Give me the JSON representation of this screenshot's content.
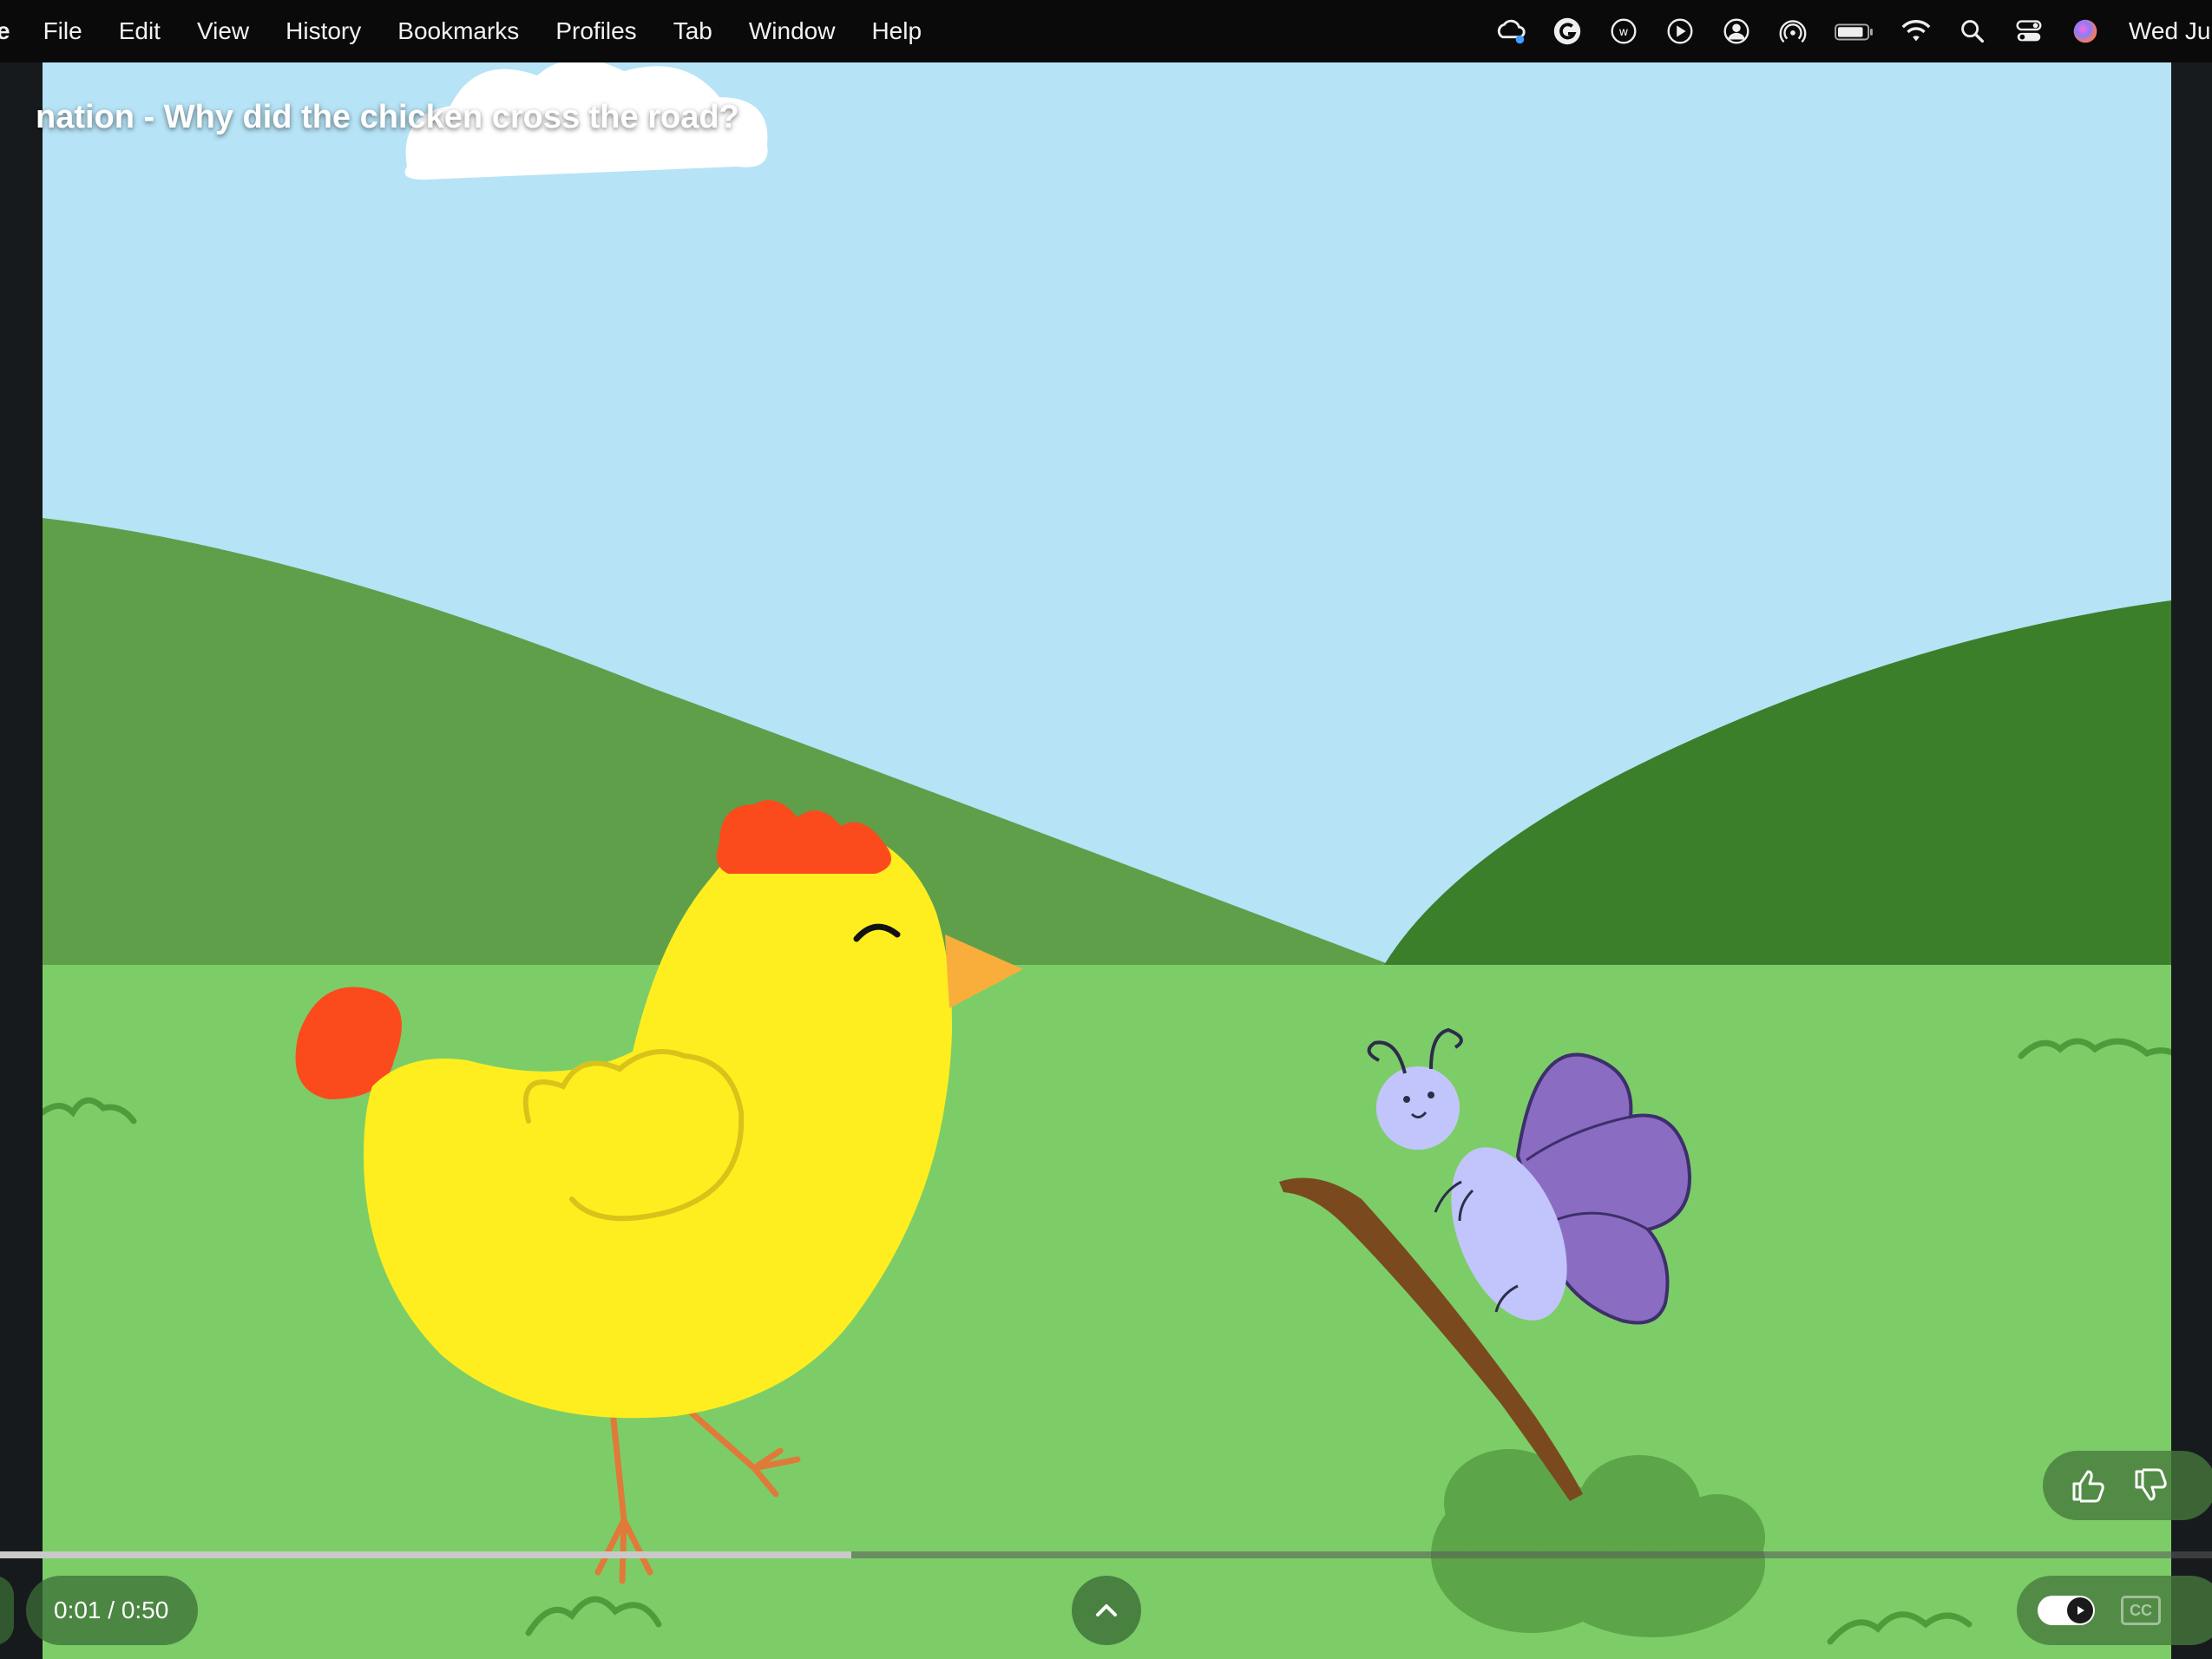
{
  "menubar": {
    "app_name_fragment": "e",
    "items": [
      "File",
      "Edit",
      "View",
      "History",
      "Bookmarks",
      "Profiles",
      "Tab",
      "Window",
      "Help"
    ],
    "clock": "Wed Jun"
  },
  "video": {
    "title": "nation - Why did the chicken cross the road?",
    "current_time": "0:01",
    "duration": "0:50",
    "time_display": "0:01 / 0:50",
    "progress_fraction": 0.385,
    "cc_label": "CC"
  },
  "icons": {
    "status": [
      "creative-cloud-icon",
      "grammarly-icon",
      "w-icon",
      "play-circle-icon",
      "user-circle-icon",
      "airdrop-icon",
      "battery-icon",
      "wifi-icon",
      "spotlight-search-icon",
      "control-center-icon",
      "siri-icon"
    ],
    "controls": [
      "like-icon",
      "dislike-icon",
      "chevron-up-icon",
      "autoplay-icon",
      "captions-icon"
    ]
  },
  "colors": {
    "sky": "#b6e3f6",
    "grass": "#7ccd68",
    "hill_light": "#5f9f4a",
    "hill_dark": "#3b7f2b",
    "chicken": "#ffee1f",
    "comb": "#fb4b1c"
  }
}
